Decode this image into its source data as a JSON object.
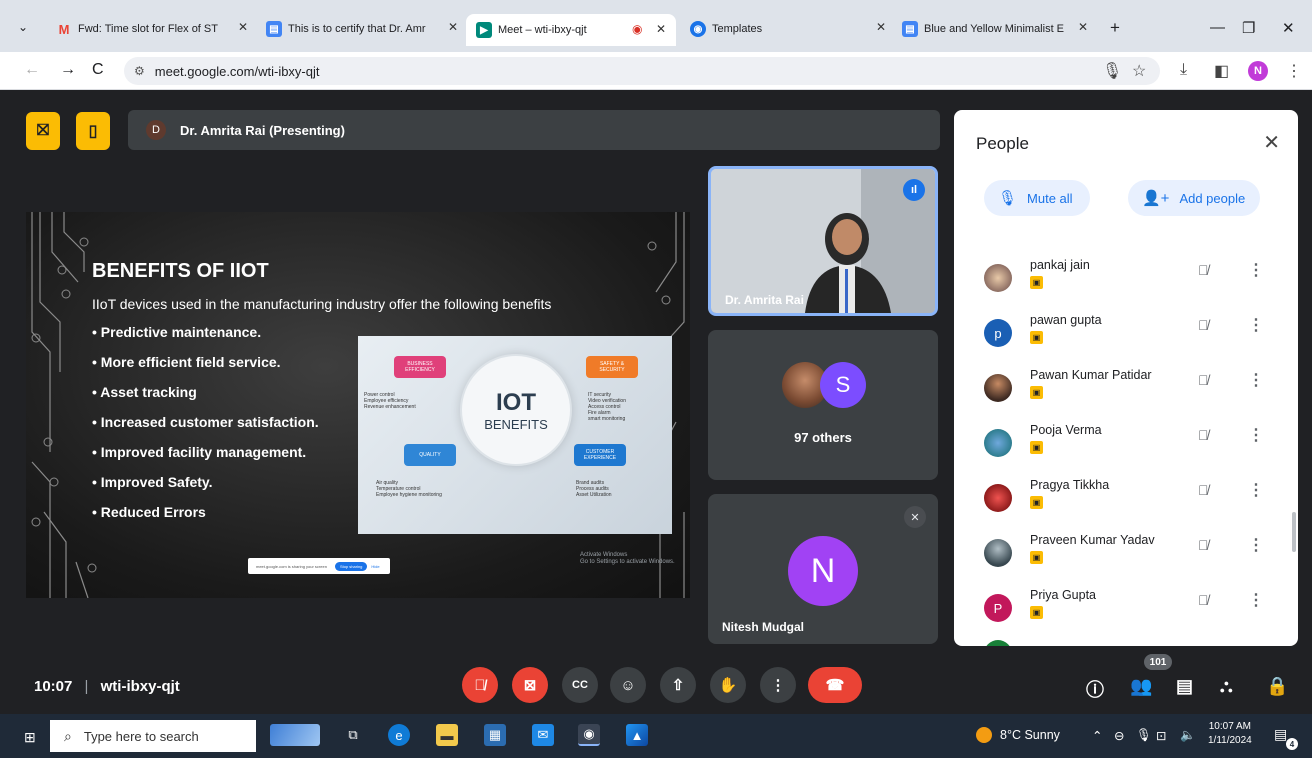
{
  "browser": {
    "tabs": [
      {
        "favicon": "M",
        "title": "Fwd: Time slot for Flex of ST"
      },
      {
        "favicon": "▤",
        "title": "This is to certify that Dr. Amr"
      },
      {
        "favicon": "▶",
        "title": "Meet – wti-ibxy-qjt"
      },
      {
        "favicon": "◉",
        "title": "Templates"
      },
      {
        "favicon": "▤",
        "title": "Blue and Yellow Minimalist E"
      }
    ],
    "new_tab": "+",
    "url": "meet.google.com/wti-ibxy-qjt",
    "profile_initial": "N"
  },
  "meet": {
    "presenter_initial": "D",
    "presenter_label": "Dr. Amrita Rai (Presenting)",
    "slide": {
      "title": "BENEFITS OF IIOT",
      "subtitle": "IIoT devices used in the manufacturing industry offer the following benefits",
      "bullets": [
        "Predictive maintenance.",
        "More efficient field service.",
        "Asset tracking",
        "Increased customer satisfaction.",
        "Improved facility management.",
        "Improved Safety.",
        "Reduced Errors"
      ],
      "iot_big": "IOT",
      "iot_small": "BENEFITS",
      "tags": {
        "business": "BUSINESS\nEFFICIENCY",
        "safety": "SAFETY &\nSECURITY",
        "quality": "QUALITY",
        "customer": "CUSTOMER\nEXPERIENCE"
      },
      "texts": {
        "business": "Power control\nEmployee efficiency\nRevenue enhancement",
        "safety": "IT security\nVideo verification\nAccess control\nFire alarm\nsmart monitoring",
        "quality": "Air quality\nTemperature control\nEmployee hygiene monitoring",
        "customer": "Brand audits\nProcess audits\nAsset Utilization"
      },
      "share_text": "meet.google.com is sharing your screen",
      "share_stop": "Stop sharing",
      "share_hide": "Hide",
      "activate": "Activate Windows\nGo to Settings to activate Windows."
    },
    "tiles": {
      "speaker": "Dr. Amrita Rai",
      "others_initial": "S",
      "others_label": "97 others",
      "nitesh_initial": "N",
      "nitesh_name": "Nitesh Mudgal"
    },
    "meeting_time": "10:07",
    "meeting_code": "wti-ibxy-qjt",
    "people_count": "101"
  },
  "people_panel": {
    "title": "People",
    "mute_all": "Mute all",
    "add_people": "Add people",
    "participants": [
      {
        "name": "pankaj jain",
        "initial": "",
        "color": "#8d6e63"
      },
      {
        "name": "pawan gupta",
        "initial": "p",
        "color": "#1a5fb4"
      },
      {
        "name": "Pawan Kumar Patidar",
        "initial": "",
        "color": "#6d4c41"
      },
      {
        "name": "Pooja Verma",
        "initial": "",
        "color": "#2e7d8f"
      },
      {
        "name": "Pragya Tikkha",
        "initial": "",
        "color": "#c62828"
      },
      {
        "name": "Praveen Kumar Yadav",
        "initial": "",
        "color": "#546e7a"
      },
      {
        "name": "Priya Gupta",
        "initial": "P",
        "color": "#c2185b"
      }
    ]
  },
  "taskbar": {
    "search_placeholder": "Type here to search",
    "weather": "8°C  Sunny",
    "time": "10:07 AM",
    "date": "1/11/2024",
    "notif_count": "4"
  }
}
